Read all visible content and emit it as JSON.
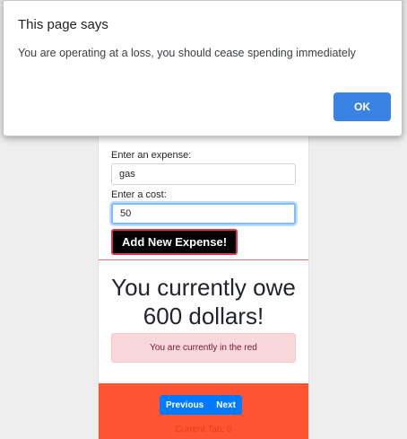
{
  "dialog": {
    "title": "This page says",
    "message": "You are operating at a loss, you should cease spending immediately",
    "ok_label": "OK"
  },
  "form": {
    "expense_label": "Enter an expense:",
    "expense_value": "gas",
    "cost_label": "Enter a cost:",
    "cost_value": "50",
    "add_button": "Add New Expense!"
  },
  "summary": {
    "owe_line1": "You currently owe",
    "owe_line2": "600 dollars!",
    "alert": "You are currently in the red"
  },
  "footer": {
    "previous": "Previous",
    "next": "Next",
    "current_tab": "Current Tab: 0"
  },
  "colors": {
    "footer_bg": "#ff5533",
    "ok_button": "#3b82e5",
    "pager": "#007bff",
    "alert_bg": "#f8d7da"
  }
}
